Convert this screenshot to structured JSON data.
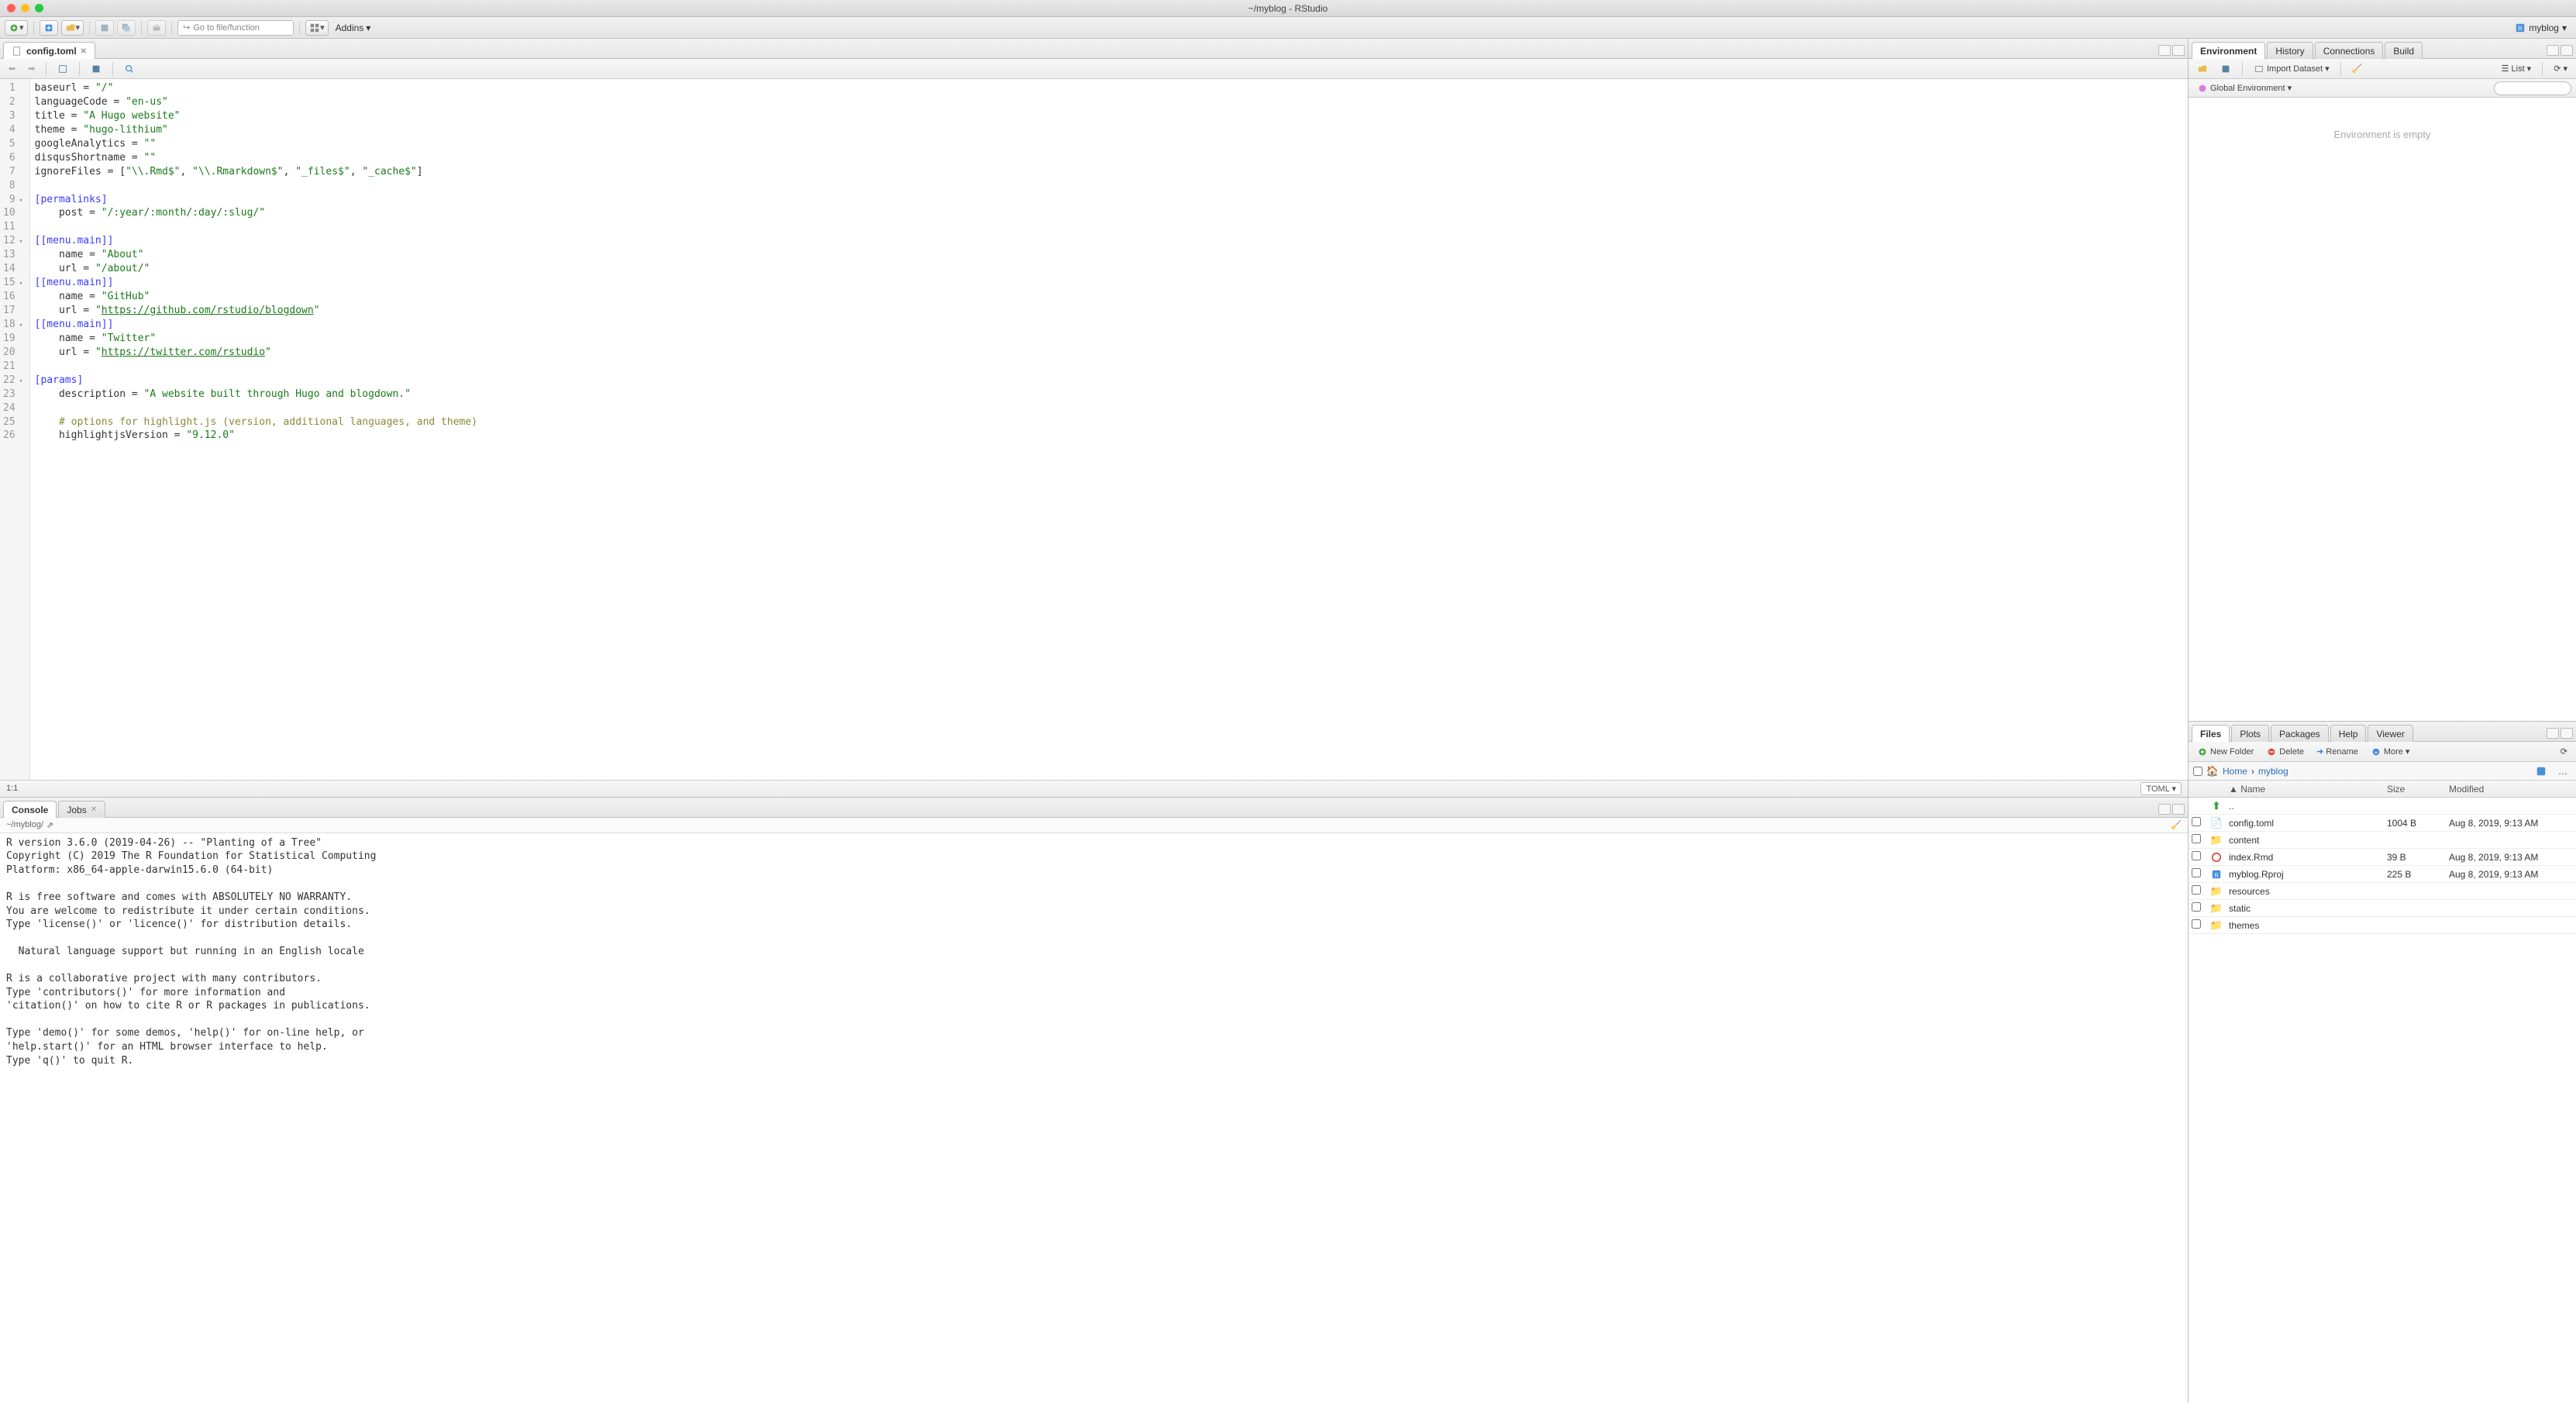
{
  "window": {
    "title": "~/myblog - RStudio"
  },
  "project": {
    "name": "myblog"
  },
  "toolbar": {
    "goto_placeholder": "Go to file/function",
    "addins": "Addins"
  },
  "editor": {
    "tab_label": "config.toml",
    "lang": "TOML",
    "cursor": "1:1",
    "lines": [
      {
        "n": 1,
        "html": "baseurl = <span class='str'>\"/\"</span>"
      },
      {
        "n": 2,
        "html": "languageCode = <span class='str'>\"en-us\"</span>"
      },
      {
        "n": 3,
        "html": "title = <span class='str'>\"A Hugo website\"</span>"
      },
      {
        "n": 4,
        "html": "theme = <span class='str'>\"hugo-lithium\"</span>"
      },
      {
        "n": 5,
        "html": "googleAnalytics = <span class='str'>\"\"</span>"
      },
      {
        "n": 6,
        "html": "disqusShortname = <span class='str'>\"\"</span>"
      },
      {
        "n": 7,
        "html": "ignoreFiles = [<span class='str'>\"\\\\.Rmd$\"</span>, <span class='str'>\"\\\\.Rmarkdown$\"</span>, <span class='str'>\"_files$\"</span>, <span class='str'>\"_cache$\"</span>]"
      },
      {
        "n": 8,
        "html": ""
      },
      {
        "n": 9,
        "html": "<span class='sec'>[permalinks]</span>",
        "fold": true
      },
      {
        "n": 10,
        "html": "    post = <span class='str'>\"/:year/:month/:day/:slug/\"</span>"
      },
      {
        "n": 11,
        "html": ""
      },
      {
        "n": 12,
        "html": "<span class='sec'>[[menu.main]]</span>",
        "fold": true
      },
      {
        "n": 13,
        "html": "    name = <span class='str'>\"About\"</span>"
      },
      {
        "n": 14,
        "html": "    url = <span class='str'>\"/about/\"</span>"
      },
      {
        "n": 15,
        "html": "<span class='sec'>[[menu.main]]</span>",
        "fold": true
      },
      {
        "n": 16,
        "html": "    name = <span class='str'>\"GitHub\"</span>"
      },
      {
        "n": 17,
        "html": "    url = <span class='str'>\"</span><span class='url'>https://github.com/rstudio/blogdown</span><span class='str'>\"</span>"
      },
      {
        "n": 18,
        "html": "<span class='sec'>[[menu.main]]</span>",
        "fold": true
      },
      {
        "n": 19,
        "html": "    name = <span class='str'>\"Twitter\"</span>"
      },
      {
        "n": 20,
        "html": "    url = <span class='str'>\"</span><span class='url'>https://twitter.com/rstudio</span><span class='str'>\"</span>"
      },
      {
        "n": 21,
        "html": ""
      },
      {
        "n": 22,
        "html": "<span class='sec'>[params]</span>",
        "fold": true
      },
      {
        "n": 23,
        "html": "    description = <span class='str'>\"A website built through Hugo and blogdown.\"</span>"
      },
      {
        "n": 24,
        "html": ""
      },
      {
        "n": 25,
        "html": "    <span class='com'># options for highlight.js (version, additional languages, and theme)</span>"
      },
      {
        "n": 26,
        "html": "    highlightjsVersion = <span class='str'>\"9.12.0\"</span>"
      }
    ]
  },
  "console": {
    "tab_console": "Console",
    "tab_jobs": "Jobs",
    "path": "~/myblog/",
    "body": "R version 3.6.0 (2019-04-26) -- \"Planting of a Tree\"\nCopyright (C) 2019 The R Foundation for Statistical Computing\nPlatform: x86_64-apple-darwin15.6.0 (64-bit)\n\nR is free software and comes with ABSOLUTELY NO WARRANTY.\nYou are welcome to redistribute it under certain conditions.\nType 'license()' or 'licence()' for distribution details.\n\n  Natural language support but running in an English locale\n\nR is a collaborative project with many contributors.\nType 'contributors()' for more information and\n'citation()' on how to cite R or R packages in publications.\n\nType 'demo()' for some demos, 'help()' for on-line help, or\n'help.start()' for an HTML browser interface to help.\nType 'q()' to quit R."
  },
  "env_pane": {
    "tabs": [
      "Environment",
      "History",
      "Connections",
      "Build"
    ],
    "import": "Import Dataset",
    "list_mode": "List",
    "scope": "Global Environment",
    "empty": "Environment is empty"
  },
  "files_pane": {
    "tabs": [
      "Files",
      "Plots",
      "Packages",
      "Help",
      "Viewer"
    ],
    "btn_new": "New Folder",
    "btn_delete": "Delete",
    "btn_rename": "Rename",
    "btn_more": "More",
    "crumb_home": "Home",
    "crumb_folder": "myblog",
    "col_name": "Name",
    "col_size": "Size",
    "col_mod": "Modified",
    "up": "..",
    "rows": [
      {
        "icon": "file",
        "name": "config.toml",
        "size": "1004 B",
        "mod": "Aug 8, 2019, 9:13 AM"
      },
      {
        "icon": "folder",
        "name": "content",
        "size": "",
        "mod": ""
      },
      {
        "icon": "rmd",
        "name": "index.Rmd",
        "size": "39 B",
        "mod": "Aug 8, 2019, 9:13 AM"
      },
      {
        "icon": "rproj",
        "name": "myblog.Rproj",
        "size": "225 B",
        "mod": "Aug 8, 2019, 9:13 AM"
      },
      {
        "icon": "folder",
        "name": "resources",
        "size": "",
        "mod": ""
      },
      {
        "icon": "folder",
        "name": "static",
        "size": "",
        "mod": ""
      },
      {
        "icon": "folder",
        "name": "themes",
        "size": "",
        "mod": ""
      }
    ]
  }
}
